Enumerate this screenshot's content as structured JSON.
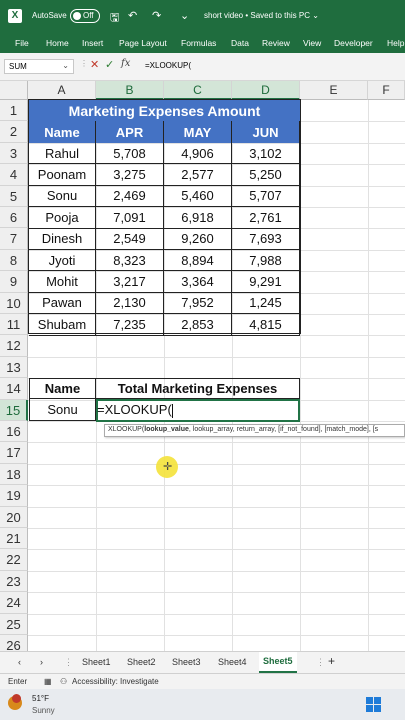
{
  "titlebar": {
    "autosave_label": "AutoSave",
    "toggle_state": "Off",
    "document_title": "short video • Saved to this PC ⌄",
    "save_icon": "save-icon",
    "undo_icon": "undo-icon",
    "redo_icon": "redo-icon"
  },
  "menu": [
    "File",
    "Home",
    "Insert",
    "Page Layout",
    "Formulas",
    "Data",
    "Review",
    "View",
    "Developer",
    "Help"
  ],
  "formula_bar": {
    "name_box": "SUM",
    "cancel_icon": "cancel-icon",
    "enter_icon": "enter-icon",
    "fx_label": "fx",
    "formula": "=XLOOKUP("
  },
  "columns": [
    "A",
    "B",
    "C",
    "D",
    "E",
    "F"
  ],
  "rows": [
    "1",
    "2",
    "3",
    "4",
    "5",
    "6",
    "7",
    "8",
    "9",
    "10",
    "11",
    "12",
    "13",
    "14",
    "15",
    "16",
    "17",
    "18",
    "19",
    "20",
    "21",
    "22",
    "23",
    "24",
    "25",
    "26"
  ],
  "table": {
    "title": "Marketing Expenses Amount",
    "headers": [
      "Name",
      "APR",
      "MAY",
      "JUN"
    ],
    "data": [
      [
        "Rahul",
        "5,708",
        "4,906",
        "3,102"
      ],
      [
        "Poonam",
        "3,275",
        "2,577",
        "5,250"
      ],
      [
        "Sonu",
        "2,469",
        "5,460",
        "5,707"
      ],
      [
        "Pooja",
        "7,091",
        "6,918",
        "2,761"
      ],
      [
        "Dinesh",
        "2,549",
        "9,260",
        "7,693"
      ],
      [
        "Jyoti",
        "8,323",
        "8,894",
        "7,988"
      ],
      [
        "Mohit",
        "3,217",
        "3,364",
        "9,291"
      ],
      [
        "Pawan",
        "2,130",
        "7,952",
        "1,245"
      ],
      [
        "Shubam",
        "7,235",
        "2,853",
        "4,815"
      ]
    ]
  },
  "lookup": {
    "name_header": "Name",
    "total_header": "Total Marketing Expenses",
    "name_value": "Sonu",
    "edit_text": "=XLOOKUP("
  },
  "tooltip": {
    "func": "XLOOKUP(",
    "current_arg": "lookup_value",
    "rest": ", lookup_array, return_array, [if_not_found], [match_mode], [s"
  },
  "sheets": {
    "nav_prev": "‹",
    "nav_next": "›",
    "tabs": [
      "Sheet1",
      "Sheet2",
      "Sheet3",
      "Sheet4",
      "Sheet5"
    ],
    "active": "Sheet5",
    "add": "+",
    "more": "⋮"
  },
  "status": {
    "mode": "Enter",
    "accessibility": "Accessibility: Investigate"
  },
  "taskbar": {
    "temperature": "51°F",
    "condition": "Sunny"
  },
  "colors": {
    "excel_green": "#1f6d3e",
    "header_blue": "#4472c4"
  }
}
